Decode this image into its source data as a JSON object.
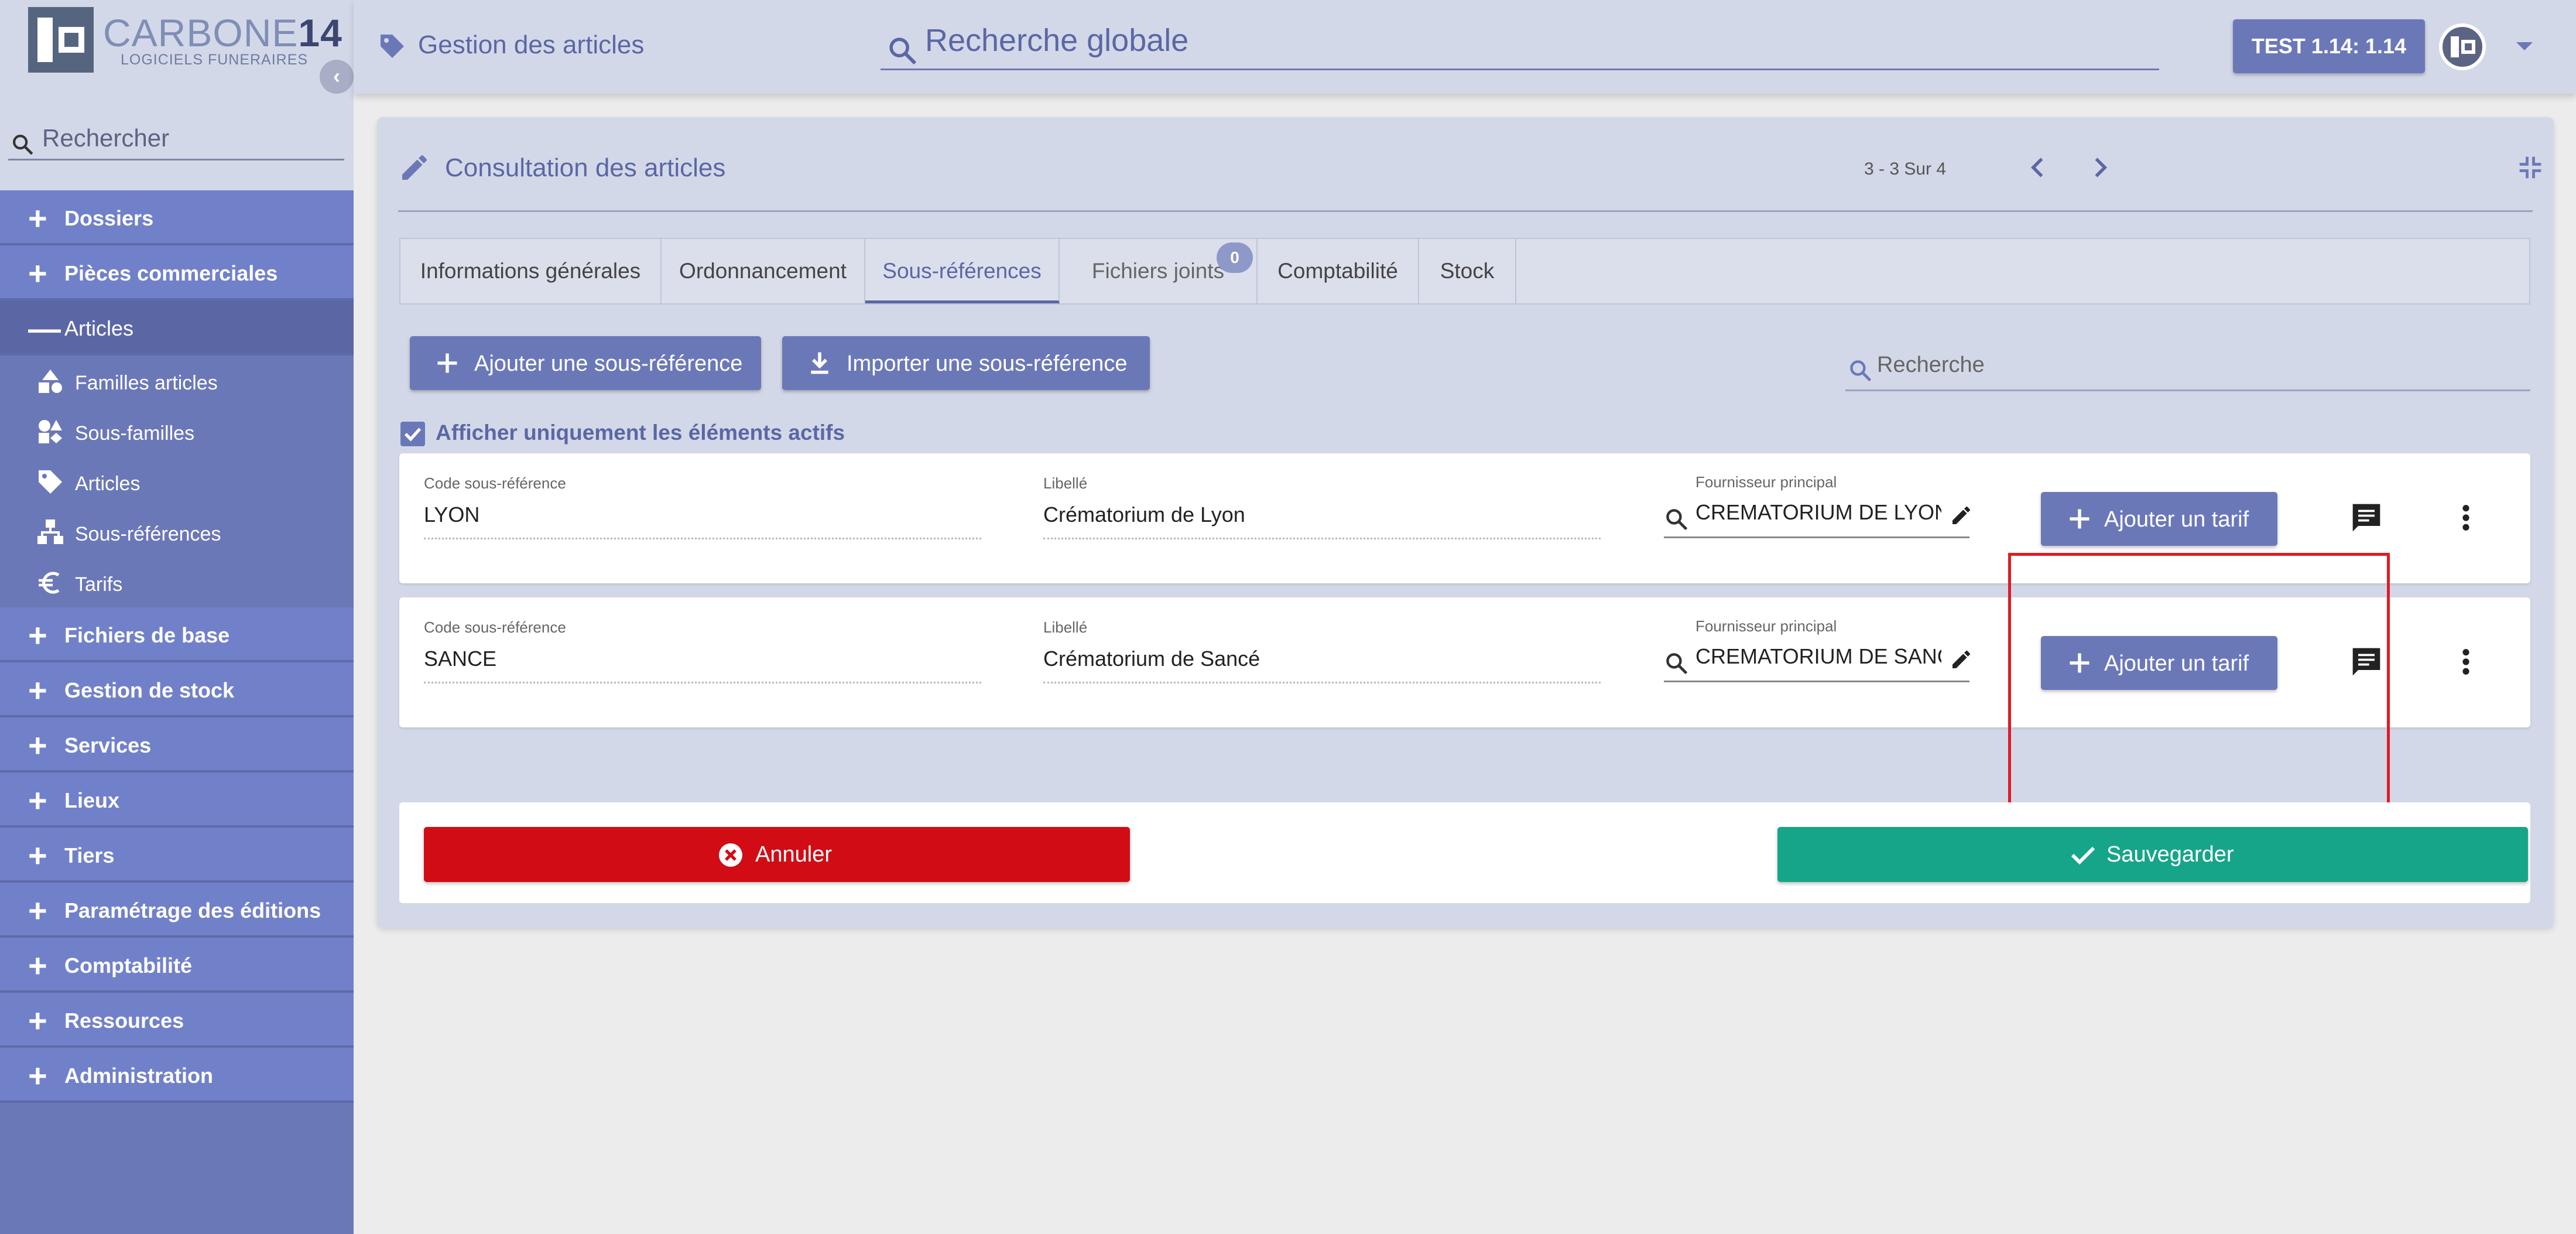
{
  "colors": {
    "primary": "#6b78b8",
    "primary_dark": "#5b67a4",
    "sidebar_item": "#7181c9",
    "topbar_bg": "#d3d8e8",
    "cancel": "#d10c14",
    "save": "#17a589",
    "highlight": "#e01b24"
  },
  "logo": {
    "name_light": "CARBONE",
    "name_bold": "14",
    "subtitle": "LOGICIELS FUNERAIRES"
  },
  "sidebar": {
    "search_placeholder": "Rechercher",
    "collapse_icon": "chevron-left-icon",
    "items": [
      {
        "label": "Dossiers",
        "icon": "plus-icon"
      },
      {
        "label": "Pièces commerciales",
        "icon": "plus-icon"
      },
      {
        "label": "Articles",
        "icon": "minus-icon"
      },
      {
        "label": "Fichiers de base",
        "icon": "plus-icon"
      },
      {
        "label": "Gestion de stock",
        "icon": "plus-icon"
      },
      {
        "label": "Services",
        "icon": "plus-icon"
      },
      {
        "label": "Lieux",
        "icon": "plus-icon"
      },
      {
        "label": "Tiers",
        "icon": "plus-icon"
      },
      {
        "label": "Paramétrage des éditions",
        "icon": "plus-icon"
      },
      {
        "label": "Comptabilité",
        "icon": "plus-icon"
      },
      {
        "label": "Ressources",
        "icon": "plus-icon"
      },
      {
        "label": "Administration",
        "icon": "plus-icon"
      }
    ],
    "sub_items": [
      {
        "label": "Familles articles",
        "icon": "shapes-icon"
      },
      {
        "label": "Sous-familles",
        "icon": "shapes-icon"
      },
      {
        "label": "Articles",
        "icon": "tag-icon"
      },
      {
        "label": "Sous-références",
        "icon": "hierarchy-icon"
      },
      {
        "label": "Tarifs",
        "icon": "euro-icon"
      }
    ]
  },
  "topbar": {
    "title": "Gestion des articles",
    "search_placeholder": "Recherche globale",
    "env_label": "TEST 1.14: 1.14"
  },
  "card": {
    "title": "Consultation des articles",
    "pagination": "3 - 3 Sur 4",
    "tabs": [
      {
        "label": "Informations générales"
      },
      {
        "label": "Ordonnancement"
      },
      {
        "label": "Sous-références",
        "active": true
      },
      {
        "label": "Fichiers joints",
        "badge": "0"
      },
      {
        "label": "Comptabilité"
      },
      {
        "label": "Stock"
      }
    ],
    "add_subref_label": "Ajouter une sous-référence",
    "import_subref_label": "Importer une sous-référence",
    "search_placeholder": "Recherche",
    "active_only_label": "Afficher uniquement les éléments actifs",
    "active_only_checked": true,
    "field_labels": {
      "code": "Code sous-référence",
      "libelle": "Libellé",
      "fournisseur": "Fournisseur principal"
    },
    "add_tarif_label": "Ajouter un tarif",
    "rows": [
      {
        "code": "LYON",
        "libelle": "Crématorium de Lyon",
        "fournisseur": "CREMATORIUM DE LYON ("
      },
      {
        "code": "SANCE",
        "libelle": "Crématorium de Sancé",
        "fournisseur": "CREMATORIUM DE SANCE"
      }
    ],
    "cancel_label": "Annuler",
    "save_label": "Sauvegarder"
  }
}
